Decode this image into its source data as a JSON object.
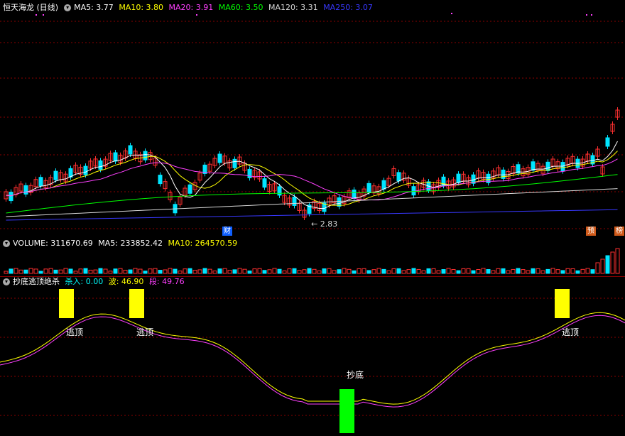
{
  "colors": {
    "up": "#ff3030",
    "down": "#00e5ff",
    "ma5": "#ffffff",
    "ma10": "#ffff00",
    "ma20": "#ff40ff",
    "ma60": "#00ff00",
    "ma120": "#d8d8d8",
    "ma250": "#3838ff",
    "grid": "#8b0000",
    "bottom_fill": "#00ff00",
    "top_fill": "#ffff00"
  },
  "icons": {
    "main_menu": "circle-dropdown-icon",
    "vol_menu": "circle-dropdown-icon",
    "ind_menu": "circle-dropdown-icon"
  },
  "main": {
    "title": "恒天海龙 (日线)",
    "ma5": "MA5: 3.77",
    "ma10": "MA10: 3.80",
    "ma20": "MA20: 3.91",
    "ma60": "MA60: 3.50",
    "ma120": "MA120: 3.31",
    "ma250": "MA250: 3.07",
    "low_marker": "2.83",
    "tag_cai": "财",
    "tag_yu": "预",
    "tag_bang": "榜"
  },
  "volume": {
    "title": "VOLUME: 311670.69",
    "ma5": "MA5: 233852.42",
    "ma10": "MA10: 264570.59"
  },
  "indicator": {
    "title": "抄底逃顶绝杀",
    "shaju": "杀入: 0.00",
    "bo": "波: 46.90",
    "duan": "段: 49.76",
    "top_label_1": "逃顶",
    "top_label_2": "逃顶",
    "top_label_3": "逃顶",
    "bottom_label": "抄底"
  }
}
